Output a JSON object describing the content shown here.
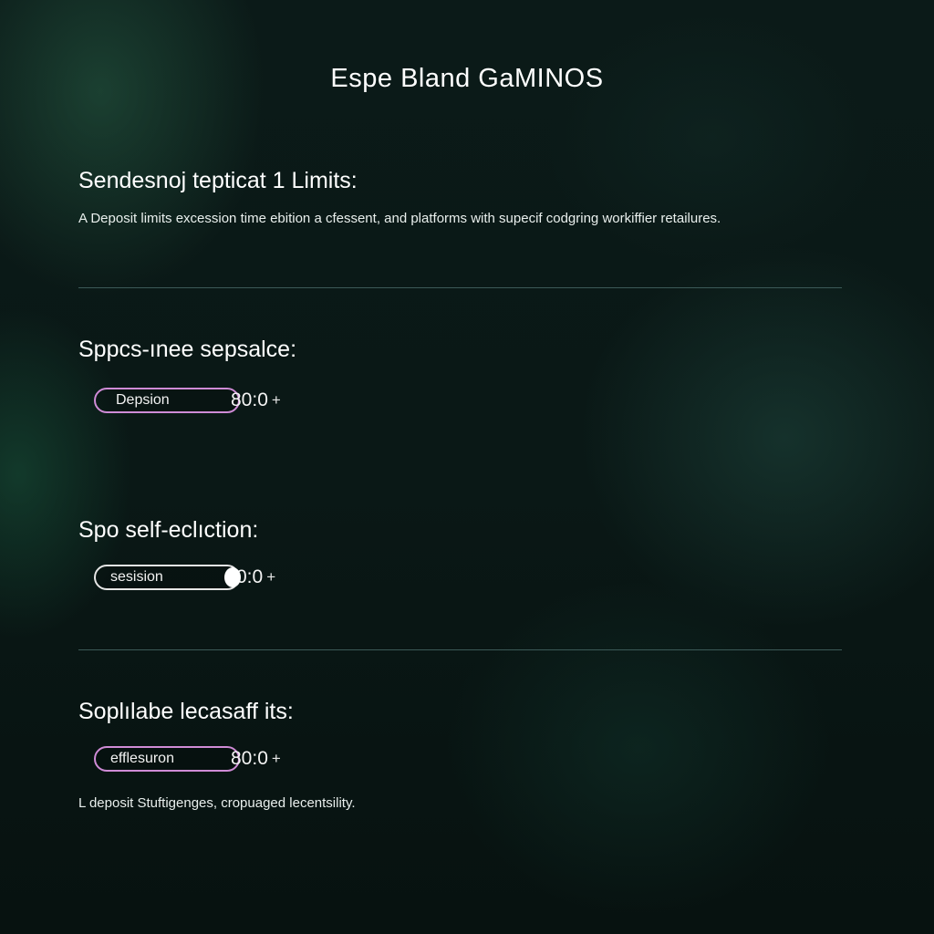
{
  "header": {
    "title": "Espe Bland GaMINOS"
  },
  "section1": {
    "title": "Sendesnoj  tepticat 1 Limits:",
    "description": "A Deposit limits excession time ebition a cfessent, and platforms with supecif codgring workiffier retailures."
  },
  "section2": {
    "title": "Sppcs-ınee sepsalce:",
    "control": {
      "label": "Depsion",
      "value": "80:0",
      "plus": "+"
    }
  },
  "section3": {
    "title": "Spo self-eclıction:",
    "control": {
      "label": "sesision",
      "value": "0:0",
      "plus": "+"
    }
  },
  "section4": {
    "title": "Soplılabe  lecasaff its:",
    "control": {
      "label": "efflesuron",
      "value": "80:0",
      "plus": "+"
    },
    "note": "L deposit Stuftigenges, cropuaged lecentsility."
  },
  "colors": {
    "accent_pill": "#cf8bd6",
    "divider": "#3c5a58",
    "background": "#0a1816"
  }
}
